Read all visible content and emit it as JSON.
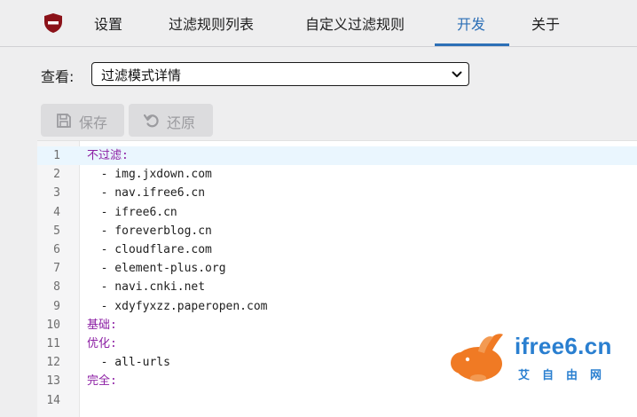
{
  "nav": {
    "tabs": [
      {
        "label": "设置"
      },
      {
        "label": "过滤规则列表"
      },
      {
        "label": "自定义过滤规则"
      },
      {
        "label": "开发",
        "active": true
      },
      {
        "label": "关于"
      }
    ],
    "logo_icon": "shield-icon",
    "accent_color": "#2c6fb6"
  },
  "view": {
    "label": "查看:",
    "selected": "过滤模式详情"
  },
  "toolbar": {
    "save_label": "保存",
    "revert_label": "还原"
  },
  "editor": {
    "lines": [
      {
        "n": "1",
        "text": "不过滤:",
        "kind": "key"
      },
      {
        "n": "2",
        "text": "  - img.jxdown.com",
        "kind": "item"
      },
      {
        "n": "3",
        "text": "  - nav.ifree6.cn",
        "kind": "item"
      },
      {
        "n": "4",
        "text": "  - ifree6.cn",
        "kind": "item"
      },
      {
        "n": "5",
        "text": "  - foreverblog.cn",
        "kind": "item"
      },
      {
        "n": "6",
        "text": "  - cloudflare.com",
        "kind": "item"
      },
      {
        "n": "7",
        "text": "  - element-plus.org",
        "kind": "item"
      },
      {
        "n": "8",
        "text": "  - navi.cnki.net",
        "kind": "item"
      },
      {
        "n": "9",
        "text": "  - xdyfyxzz.paperopen.com",
        "kind": "item"
      },
      {
        "n": "10",
        "text": "基础:",
        "kind": "key"
      },
      {
        "n": "11",
        "text": "优化:",
        "kind": "key"
      },
      {
        "n": "12",
        "text": "  - all-urls",
        "kind": "item"
      },
      {
        "n": "13",
        "text": "完全:",
        "kind": "key"
      },
      {
        "n": "14",
        "text": "",
        "kind": "item"
      }
    ]
  },
  "watermark": {
    "brand": "ifree6.cn",
    "sub": "艾自由网"
  }
}
